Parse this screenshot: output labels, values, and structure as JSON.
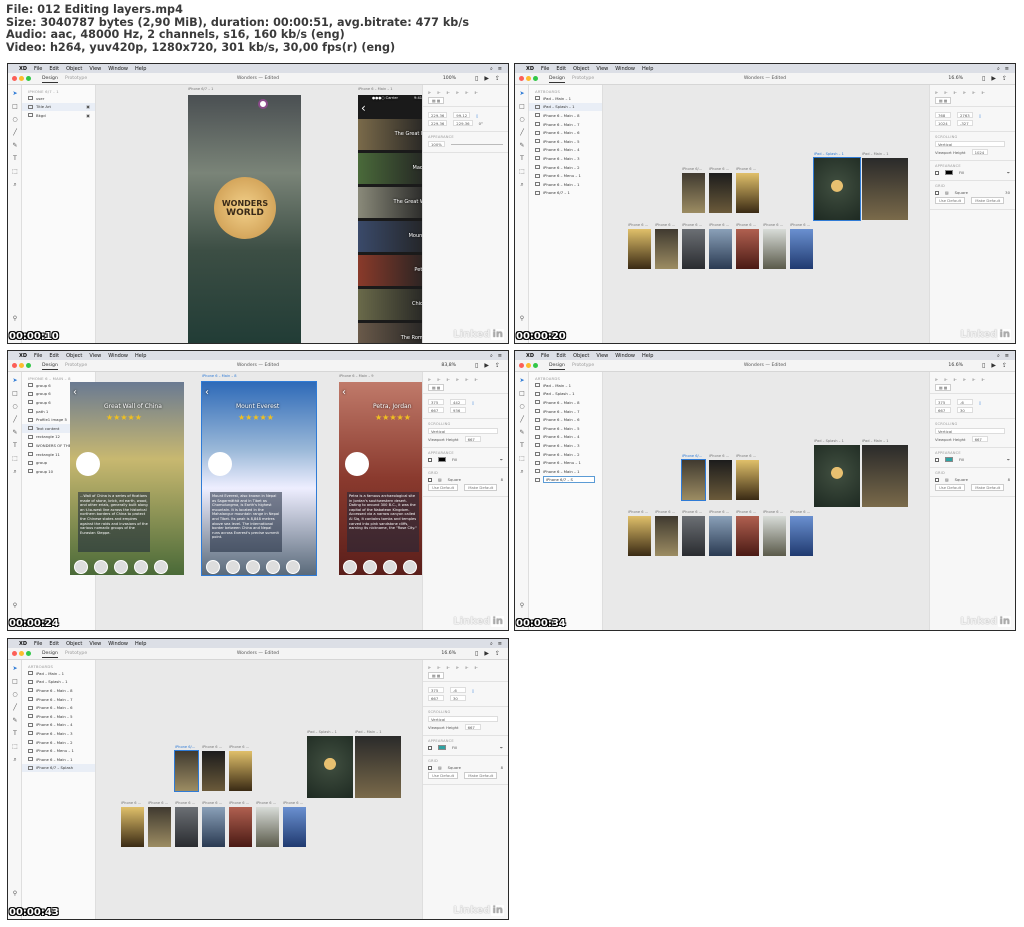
{
  "video_info": {
    "line1": "File: 012 Editing layers.mp4",
    "line2": "Size: 3040787 bytes (2,90 MiB), duration: 00:00:51, avg.bitrate: 477 kb/s",
    "line3": "Audio: aac, 48000 Hz, 2 channels, s16, 160 kb/s (eng)",
    "line4": "Video: h264, yuv420p, 1280x720, 301 kb/s, 30,00 fps(r) (eng)"
  },
  "menubar": {
    "apple": "",
    "app": "XD",
    "items": [
      "File",
      "Edit",
      "Object",
      "View",
      "Window",
      "Help"
    ]
  },
  "toolbar": {
    "tab_design": "Design",
    "tab_prototype": "Prototype",
    "title": "Wonders — Edited"
  },
  "watermark": {
    "brand": "Linked",
    "brand_in": "in"
  },
  "frames": [
    {
      "timestamp": "00:00:10",
      "zoom": "100%",
      "layers_header": "IPHONE 6/7 - 1",
      "layers": [
        {
          "name": "user",
          "lock": false,
          "sel": false
        },
        {
          "name": "Title Art",
          "lock": true,
          "sel": true
        },
        {
          "name": "Bkgd",
          "lock": true,
          "sel": false
        }
      ],
      "artboard_labels": [
        "iPhone 6/7 – 1",
        "iPhone 6 – Main – 1"
      ],
      "logo_line1": "WONDERS",
      "logo_line2": "WORLD",
      "list_items": [
        "The Great Pyr",
        "Machu",
        "The Great Wal",
        "Mount E",
        "Petra, ",
        "Chiche",
        "The Roman "
      ],
      "phone_status": "●●●○ Carrier",
      "phone_time": "9:41",
      "inspector": {
        "field1": "229.36",
        "field2": "99.12",
        "field3": "229.36",
        "field4": "229.36",
        "rotation": "0°",
        "appearance_label": "APPEARANCE",
        "opacity": "100%"
      }
    },
    {
      "timestamp": "00:00:20",
      "zoom": "16.6%",
      "layers_header": "ARTBOARDS",
      "layers": [
        {
          "name": "iPad – Main – 1",
          "sel": false
        },
        {
          "name": "iPad – Splash – 1",
          "sel": true
        },
        {
          "name": "iPhone 6 – Main – 8",
          "sel": false
        },
        {
          "name": "iPhone 6 – Main – 7",
          "sel": false
        },
        {
          "name": "iPhone 6 – Main – 6",
          "sel": false
        },
        {
          "name": "iPhone 6 – Main – 5",
          "sel": false
        },
        {
          "name": "iPhone 6 – Main – 4",
          "sel": false
        },
        {
          "name": "iPhone 6 – Main – 3",
          "sel": false
        },
        {
          "name": "iPhone 6 – Main – 2",
          "sel": false
        },
        {
          "name": "iPhone 6 – Menu – 1",
          "sel": false
        },
        {
          "name": "iPhone 6 – Main – 1",
          "sel": false
        },
        {
          "name": "iPhone 6/7 – 1",
          "sel": false
        }
      ],
      "inspector": {
        "field1": "768",
        "field2": "2763",
        "field3": "1024",
        "field4": "-327",
        "scrolling_label": "SCROLLING",
        "scrolling": "Vertical",
        "viewport_label": "Viewport Height",
        "viewport": "1024",
        "appearance_label": "APPEARANCE",
        "fill_label": "Fill",
        "grid_label": "GRID",
        "grid_type": "Square",
        "grid_size": "30",
        "use_default": "Use Default",
        "make_default": "Make Default"
      }
    },
    {
      "timestamp": "00:00:24",
      "zoom": "83,8%",
      "layers_header": "IPHONE 6 – MAIN – 8",
      "layers": [
        {
          "name": "group 6",
          "sel": false
        },
        {
          "name": "group 6",
          "sel": false
        },
        {
          "name": "group 6",
          "sel": false
        },
        {
          "name": "path 1",
          "sel": false
        },
        {
          "name": "Profile1 image 5",
          "sel": false
        },
        {
          "name": "Text content",
          "sel": true
        },
        {
          "name": "rectangle 12",
          "sel": false
        },
        {
          "name": "WONDERS OF THE",
          "sel": false
        },
        {
          "name": "rectangle 11",
          "sel": false
        },
        {
          "name": "group",
          "sel": false
        },
        {
          "name": "group 10",
          "sel": false
        }
      ],
      "card1_title": "Great Wall of China",
      "card1_text": "...Wall of China is a series of fications made of stone, brick, ed earth, wood, and other erials, generally built along an t-to-west line across the historical northern borders of China to protect the Chinese states and empires against the raids and invasions of the various nomadic groups of the Eurasian Steppe.",
      "card2_label": "iPhone 6 – Main – 8",
      "card2_title": "Mount Everest",
      "card2_text": "Mount Everest, also known in Nepal as Sagarmāthā and in Tibet as Chomolungma, is Earth's highest mountain. It is located in the Mahalangur mountain range in Nepal and Tibet. Its peak is 8,848 metres above sea level. The international border between China and Nepal runs across Everest's precise summit point.",
      "card3_label": "iPhone 6 – Main – 9",
      "card3_title": "Petra, Jordan",
      "card3_text": "Petra is a famous archaeological site in Jordan's southwestern desert. Dating to around 300 B.C., it was the capital of the Nabatean Kingdom. Accessed via a narrow canyon called Al Siq, it contains tombs and temples carved into pink sandstone cliffs, earning its nickname, the \"Rose City.\"",
      "stars": "★★★★★",
      "inspector": {
        "field1": "375",
        "field2": "442",
        "field3": "667",
        "field4": "936",
        "scrolling_label": "SCROLLING",
        "scrolling": "Vertical",
        "viewport_label": "Viewport Height",
        "viewport": "667",
        "appearance_label": "APPEARANCE",
        "fill_label": "Fill",
        "grid_label": "GRID",
        "grid_type": "Square",
        "grid_size": "8",
        "use_default": "Use Default",
        "make_default": "Make Default"
      }
    },
    {
      "timestamp": "00:00:34",
      "zoom": "16.6%",
      "layers_header": "ARTBOARDS",
      "layers": [
        {
          "name": "iPad – Main – 1",
          "sel": false
        },
        {
          "name": "iPad – Splash – 1",
          "sel": false
        },
        {
          "name": "iPhone 6 – Main – 8",
          "sel": false
        },
        {
          "name": "iPhone 6 – Main – 7",
          "sel": false
        },
        {
          "name": "iPhone 6 – Main – 6",
          "sel": false
        },
        {
          "name": "iPhone 6 – Main – 5",
          "sel": false
        },
        {
          "name": "iPhone 6 – Main – 4",
          "sel": false
        },
        {
          "name": "iPhone 6 – Main – 3",
          "sel": false
        },
        {
          "name": "iPhone 6 – Main – 2",
          "sel": false
        },
        {
          "name": "iPhone 6 – Menu – 1",
          "sel": false
        },
        {
          "name": "iPhone 6 – Main – 1",
          "sel": false
        },
        {
          "name": "iPhone 6/7 – S",
          "sel": false,
          "editing": true
        }
      ],
      "inspector": {
        "field1": "375",
        "field2": "-6",
        "field3": "667",
        "field4": "30",
        "scrolling_label": "SCROLLING",
        "scrolling": "Vertical",
        "viewport_label": "Viewport Height",
        "viewport": "667",
        "appearance_label": "APPEARANCE",
        "fill_label": "Fill",
        "grid_label": "GRID",
        "grid_type": "Square",
        "grid_size": "8",
        "use_default": "Use Default",
        "make_default": "Make Default"
      }
    },
    {
      "timestamp": "00:00:43",
      "zoom": "16.6%",
      "layers_header": "ARTBOARDS",
      "layers": [
        {
          "name": "iPad – Main – 1",
          "sel": false
        },
        {
          "name": "iPad – Splash – 1",
          "sel": false
        },
        {
          "name": "iPhone 6 – Main – 8",
          "sel": false
        },
        {
          "name": "iPhone 6 – Main – 7",
          "sel": false
        },
        {
          "name": "iPhone 6 – Main – 6",
          "sel": false
        },
        {
          "name": "iPhone 6 – Main – 5",
          "sel": false
        },
        {
          "name": "iPhone 6 – Main – 4",
          "sel": false
        },
        {
          "name": "iPhone 6 – Main – 3",
          "sel": false
        },
        {
          "name": "iPhone 6 – Main – 2",
          "sel": false
        },
        {
          "name": "iPhone 6 – Menu – 1",
          "sel": false
        },
        {
          "name": "iPhone 6 – Main – 1",
          "sel": false
        },
        {
          "name": "iPhone 6/7 – Splash",
          "sel": true
        }
      ],
      "inspector": {
        "field1": "375",
        "field2": "-6",
        "field3": "667",
        "field4": "30",
        "scrolling_label": "SCROLLING",
        "scrolling": "Vertical",
        "viewport_label": "Viewport Height",
        "viewport": "667",
        "appearance_label": "APPEARANCE",
        "fill_label": "Fill",
        "grid_label": "GRID",
        "grid_type": "Square",
        "grid_size": "8",
        "use_default": "Use Default",
        "make_default": "Make Default"
      }
    }
  ],
  "overview_labels": {
    "top_row": [
      "iPhone 6/...",
      "iPhone 6 ...",
      "iPhone 6 ..."
    ],
    "ipad": [
      "iPad – Splash – 1",
      "iPad – Main – 1"
    ],
    "bottom_row": [
      "iPhone 6 ...",
      "iPhone 6 ...",
      "iPhone 6 ...",
      "iPhone 6 ...",
      "iPhone 6 ...",
      "iPhone 6 ...",
      "iPhone 6 ..."
    ]
  },
  "colors": {
    "accent": "#2f7bd6",
    "fill_black": "#000000",
    "fill_teal": "#2ea3a3",
    "red_dot": "#fc5f57",
    "yellow_dot": "#fdbc2e",
    "green_dot": "#33c748"
  }
}
